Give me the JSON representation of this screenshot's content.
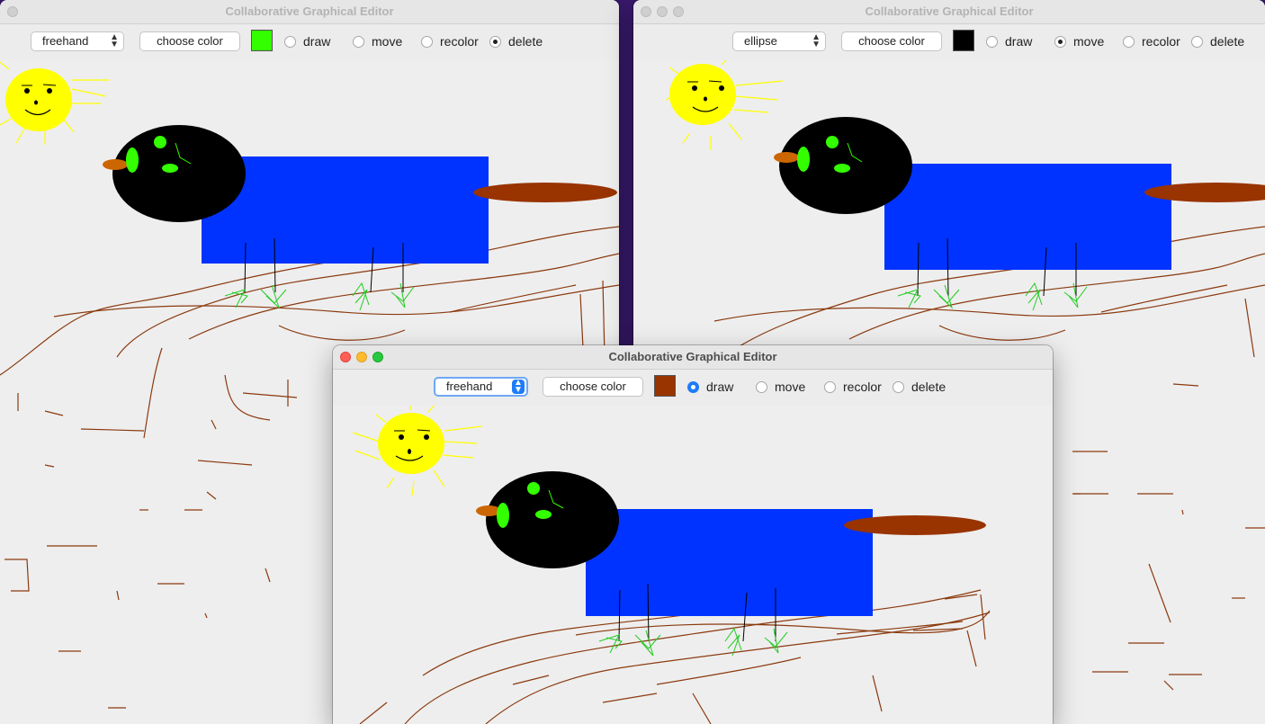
{
  "windows": [
    {
      "title": "Collaborative Graphical Editor",
      "shape_mode": "freehand",
      "choose_color_label": "choose color",
      "swatch_color": "#33ff00",
      "modes": [
        {
          "label": "draw",
          "selected": false
        },
        {
          "label": "move",
          "selected": false
        },
        {
          "label": "recolor",
          "selected": false
        },
        {
          "label": "delete",
          "selected": true
        }
      ]
    },
    {
      "title": "Collaborative Graphical Editor",
      "shape_mode": "ellipse",
      "choose_color_label": "choose color",
      "swatch_color": "#000000",
      "modes": [
        {
          "label": "draw",
          "selected": false
        },
        {
          "label": "move",
          "selected": true
        },
        {
          "label": "recolor",
          "selected": false
        },
        {
          "label": "delete",
          "selected": false
        }
      ]
    },
    {
      "title": "Collaborative Graphical Editor",
      "shape_mode": "freehand",
      "choose_color_label": "choose color",
      "swatch_color": "#993300",
      "modes": [
        {
          "label": "draw",
          "selected": true
        },
        {
          "label": "move",
          "selected": false
        },
        {
          "label": "recolor",
          "selected": false
        },
        {
          "label": "delete",
          "selected": false
        }
      ]
    }
  ],
  "drawing_colors": {
    "sun": "#ffff00",
    "body": "#000000",
    "rectangle": "#0033ff",
    "tail": "#993300",
    "beak": "#cc6600",
    "eyes": "#33ff00",
    "ground_lines": "#8b3a0f",
    "grass": "#22cc22"
  }
}
